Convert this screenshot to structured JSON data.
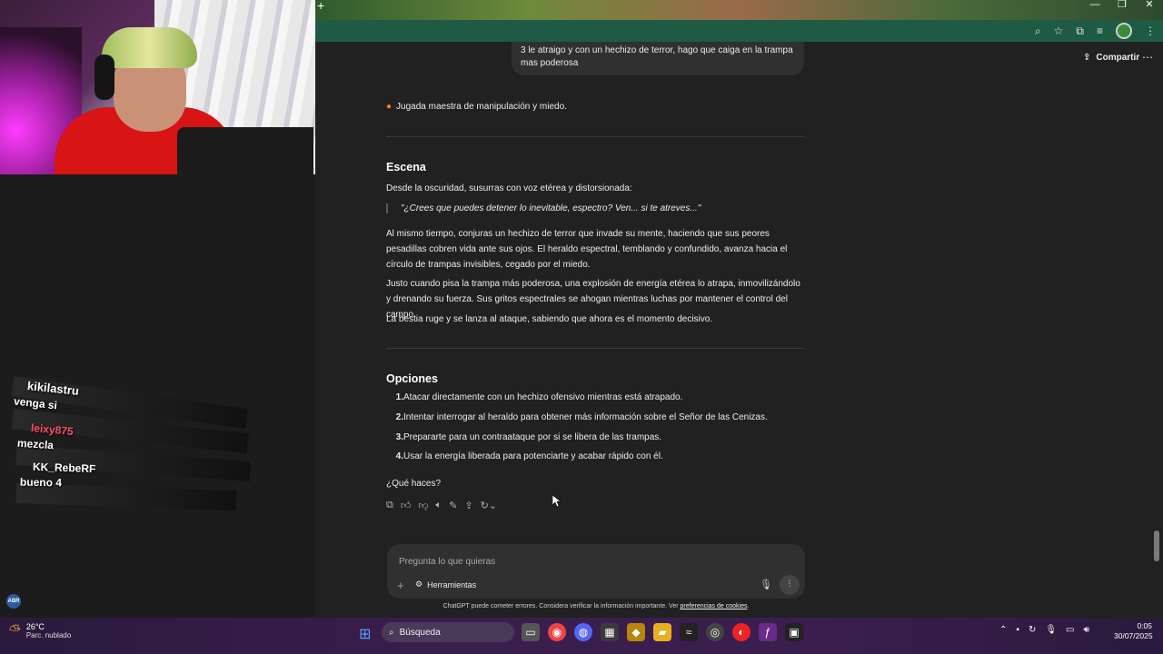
{
  "browser": {
    "toolbar_icons": [
      "zoom-icon",
      "star-icon",
      "extensions-icon",
      "media-icon",
      "profile-avatar",
      "kebab-icon"
    ]
  },
  "header": {
    "share_label": "Compartir"
  },
  "chat": {
    "user_message": "3 le atraigo y con un hechizo de terror, hago que caiga en la trampa mas poderosa",
    "highlight": "Jugada maestra de manipulación y miedo.",
    "scene_heading": "Escena",
    "scene_intro": "Desde la oscuridad, susurras con voz etérea y distorsionada:",
    "scene_quote": "\"¿Crees que puedes detener lo inevitable, espectro? Ven... si te atreves...\"",
    "paragraphs": [
      "Al mismo tiempo, conjuras un hechizo de terror que invade su mente, haciendo que sus peores pesadillas cobren vida ante sus ojos. El heraldo espectral, temblando y confundido, avanza hacia el círculo de trampas invisibles, cegado por el miedo.",
      "Justo cuando pisa la trampa más poderosa, una explosión de energía etérea lo atrapa, inmovilizándolo y drenando su fuerza. Sus gritos espectrales se ahogan mientras luchas por mantener el control del campo.",
      "La bestia ruge y se lanza al ataque, sabiendo que ahora es el momento decisivo."
    ],
    "options_heading": "Opciones",
    "options": [
      {
        "n": "1.",
        "text": "Atacar directamente con un hechizo ofensivo mientras está atrapado."
      },
      {
        "n": "2.",
        "text": "Intentar interrogar al heraldo para obtener más información sobre el Señor de las Cenizas."
      },
      {
        "n": "3.",
        "text": "Prepararte para un contraataque por si se libera de las trampas."
      },
      {
        "n": "4.",
        "text": "Usar la energía liberada para potenciarte y acabar rápido con él."
      }
    ],
    "closing_question": "¿Qué haces?"
  },
  "composer": {
    "placeholder": "Pregunta lo que quieras",
    "tools_label": "Herramientas"
  },
  "disclaimer": {
    "text": "ChatGPT puede cometer errores. Considera verificar la información importante. Ver",
    "link": "preferencias de cookies"
  },
  "stream_chat": [
    {
      "user": "kikilastru",
      "message": "venga si"
    },
    {
      "user": "leixy875",
      "message": "mezcla"
    },
    {
      "user": "KK_RebeRF",
      "message": "bueno 4"
    }
  ],
  "taskbar": {
    "temperature": "26°C",
    "condition": "Parc. nublado",
    "search_label": "Búsqueda",
    "time": "0:05",
    "date": "30/07/2025",
    "language_badge": "ABR"
  },
  "colors": {
    "page_bg": "#212121",
    "bubble_bg": "#303030",
    "browser_toolbar": "#1f5a44",
    "taskbar": "#3a1e4e",
    "username_color_1": "#ffffff",
    "username_color_2": "#ff4d6a"
  }
}
